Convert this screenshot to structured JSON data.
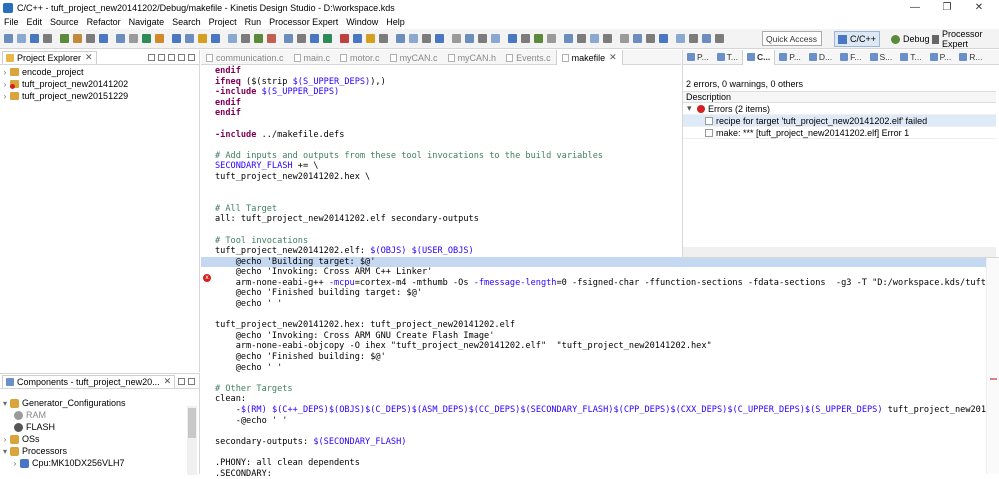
{
  "window": {
    "title": "C/C++ - tuft_project_new20141202/Debug/makefile - Kinetis Design Studio - D:\\workspace.kds",
    "controls": [
      "—",
      "❐",
      "✕"
    ]
  },
  "menu": [
    "File",
    "Edit",
    "Source",
    "Refactor",
    "Navigate",
    "Search",
    "Project",
    "Run",
    "Processor Expert",
    "Window",
    "Help"
  ],
  "toolbar": {
    "quick_access_placeholder": "Quick Access",
    "perspectives": [
      "C/C++",
      "Debug",
      "Processor Expert"
    ]
  },
  "project_explorer": {
    "title": "Project Explorer",
    "items": [
      {
        "label": "encode_project",
        "error": false
      },
      {
        "label": "tuft_project_new20141202",
        "error": true
      },
      {
        "label": "tuft_project_new20151229",
        "error": false
      }
    ]
  },
  "components": {
    "title": "Components - tuft_project_new20...",
    "items": [
      {
        "label": "Generator_Configurations",
        "level": 0,
        "arrow": "▾"
      },
      {
        "label": "RAM",
        "level": 1,
        "arrow": ""
      },
      {
        "label": "FLASH",
        "level": 1,
        "arrow": ""
      },
      {
        "label": "OSs",
        "level": 0,
        "arrow": "›"
      },
      {
        "label": "Processors",
        "level": 0,
        "arrow": "▾"
      },
      {
        "label": "Cpu:MK10DX256VLH7",
        "level": 1,
        "arrow": "›"
      }
    ]
  },
  "editor": {
    "tabs": [
      {
        "label": "communication.c",
        "active": false
      },
      {
        "label": "main.c",
        "active": false
      },
      {
        "label": "motor.c",
        "active": false
      },
      {
        "label": "myCAN.c",
        "active": false
      },
      {
        "label": "myCAN.h",
        "active": false
      },
      {
        "label": "Events.c",
        "active": false
      },
      {
        "label": "makefile",
        "active": true
      }
    ],
    "lines": [
      "endif",
      "ifneq ($(strip $(S_UPPER_DEPS)),)",
      "-include $(S_UPPER_DEPS)",
      "endif",
      "endif",
      "",
      "-include ../makefile.defs",
      "",
      "# Add inputs and outputs from these tool invocations to the build variables",
      "SECONDARY_FLASH += \\",
      "tuft_project_new20141202.hex \\",
      "",
      "",
      "# All Target",
      "all: tuft_project_new20141202.elf secondary-outputs",
      "",
      "# Tool invocations",
      "tuft_project_new20141202.elf: $(OBJS) $(USER_OBJS)",
      "\t@echo 'Building target: $@'",
      "\t@echo 'Invoking: Cross ARM C++ Linker'",
      "\tarm-none-eabi-g++ -mcpu=cortex-m4 -mthumb -Os -fmessage-length=0 -fsigned-char -ffunction-sections -fdata-sections  -g3 -T \"D:/workspace.kds/tuft_project_ne",
      "\t@echo 'Finished building target: $@'",
      "\t@echo ' '",
      "",
      "tuft_project_new20141202.hex: tuft_project_new20141202.elf",
      "\t@echo 'Invoking: Cross ARM GNU Create Flash Image'",
      "\tarm-none-eabi-objcopy -O ihex \"tuft_project_new20141202.elf\"  \"tuft_project_new20141202.hex\"",
      "\t@echo 'Finished building: $@'",
      "\t@echo ' '",
      "",
      "# Other Targets",
      "clean:",
      "\t-$(RM) $(C++_DEPS)$(OBJS)$(C_DEPS)$(ASM_DEPS)$(CC_DEPS)$(SECONDARY_FLASH)$(CPP_DEPS)$(CXX_DEPS)$(C_UPPER_DEPS)$(S_UPPER_DEPS) tuft_project_new20141202.elf",
      "\t-@echo ' '",
      "",
      "secondary-outputs: $(SECONDARY_FLASH)",
      "",
      ".PHONY: all clean dependents",
      ".SECONDARY:"
    ],
    "highlighted_line": 18,
    "error_marker": "x"
  },
  "problems": {
    "tabs": [
      "P...",
      "T...",
      "C...",
      "P...",
      "D...",
      "F...",
      "S...",
      "T...",
      "P...",
      "R..."
    ],
    "active_tab": 2,
    "summary": "2 errors, 0 warnings, 0 others",
    "column_header": "Description",
    "group": "Errors (2 items)",
    "rows": [
      "recipe for target 'tuft_project_new20141202.elf' failed",
      "make: *** [tuft_project_new20141202.elf] Error 1"
    ]
  }
}
